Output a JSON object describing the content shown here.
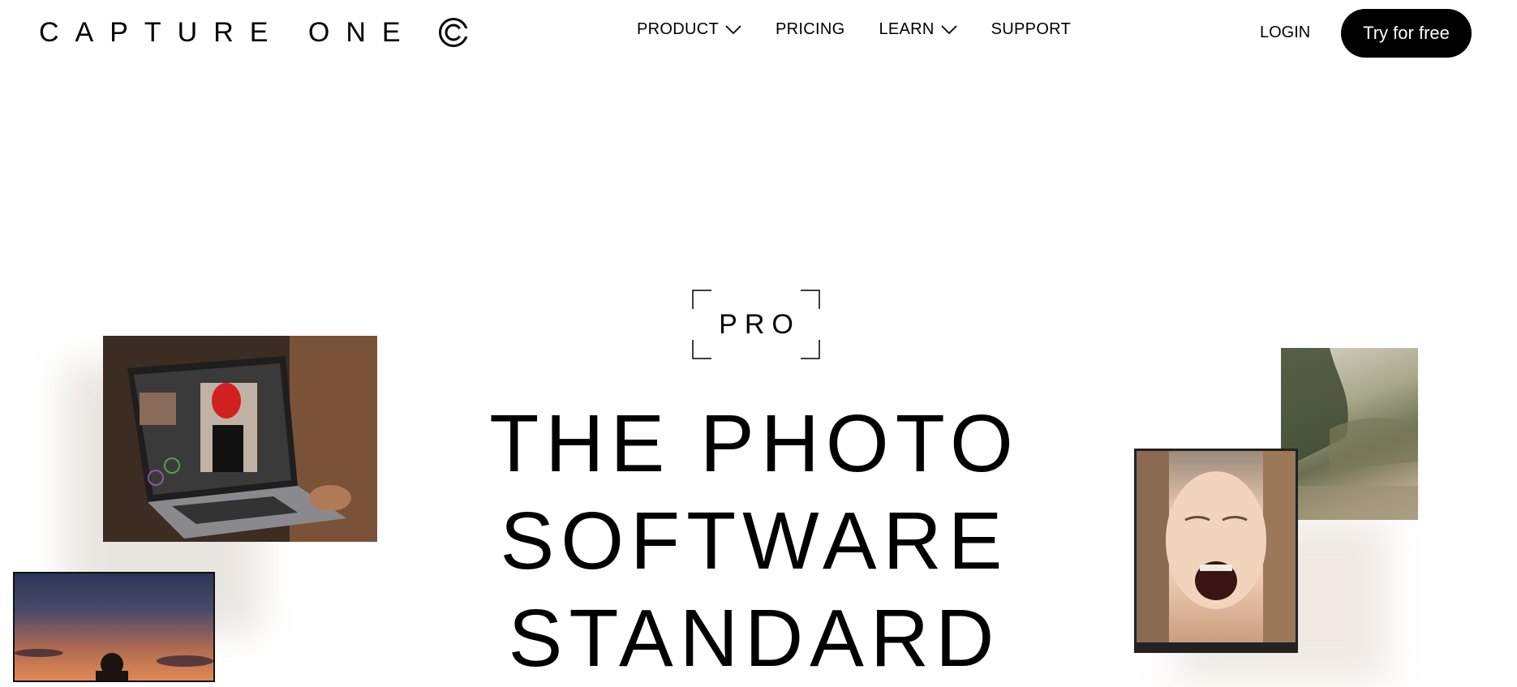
{
  "header": {
    "logo_text": "CAPTURE ONE",
    "nav": [
      {
        "label": "PRODUCT",
        "has_dropdown": true
      },
      {
        "label": "PRICING",
        "has_dropdown": false
      },
      {
        "label": "LEARN",
        "has_dropdown": true
      },
      {
        "label": "SUPPORT",
        "has_dropdown": false
      }
    ],
    "login_label": "LOGIN",
    "cta_label": "Try for free"
  },
  "hero": {
    "badge": "PRO",
    "title_lines": [
      "THE PHOTO",
      "SOFTWARE",
      "STANDARD"
    ]
  },
  "icons": {
    "logo_mark": "capture-one-logo-icon",
    "dropdown": "chevron-down-icon"
  },
  "colors": {
    "background": "#ffffff",
    "text": "#000000",
    "cta_background": "#000000",
    "cta_text": "#ffffff"
  }
}
